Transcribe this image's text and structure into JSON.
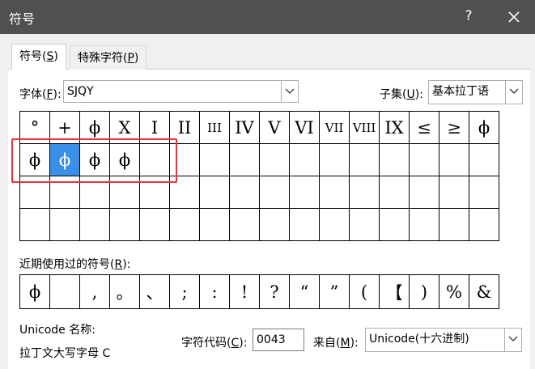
{
  "window": {
    "title": "符号",
    "help": "?"
  },
  "tabs": [
    {
      "label": "符号(",
      "hotkey": "S",
      "suffix": ")"
    },
    {
      "label": "特殊字符(",
      "hotkey": "P",
      "suffix": ")"
    }
  ],
  "font": {
    "label_pre": "字体(",
    "hotkey": "F",
    "label_post": "):",
    "value": "SJQY"
  },
  "subset": {
    "label_pre": "子集(",
    "hotkey": "U",
    "label_post": "):",
    "value": "基本拉丁语"
  },
  "symbol_grid": {
    "rows": [
      [
        "°",
        "+",
        "ϕ",
        "X",
        "I",
        "II",
        "III",
        "IV",
        "V",
        "VI",
        "VII",
        "VIII",
        "IX",
        "≤",
        "≥",
        "ϕ"
      ],
      [
        "ϕ",
        "ϕ",
        "ϕ",
        "ϕ",
        "",
        "",
        "",
        "",
        "",
        "",
        "",
        "",
        "",
        "",
        "",
        ""
      ],
      [
        "",
        "",
        "",
        "",
        "",
        "",
        "",
        "",
        "",
        "",
        "",
        "",
        "",
        "",
        "",
        ""
      ],
      [
        "",
        "",
        "",
        "",
        "",
        "",
        "",
        "",
        "",
        "",
        "",
        "",
        "",
        "",
        "",
        ""
      ]
    ]
  },
  "recent": {
    "label_pre": "近期使用过的符号(",
    "hotkey": "R",
    "label_post": "):",
    "items": [
      "ϕ",
      "",
      ",",
      "。",
      "、",
      ";",
      ":",
      "!",
      "?",
      "“",
      "”",
      "(",
      "【",
      ")",
      "%",
      "&"
    ]
  },
  "unicode_name": {
    "label": "Unicode 名称:",
    "value": "拉丁文大写字母 C"
  },
  "char_code": {
    "label_pre": "字符代码(",
    "hotkey": "C",
    "label_post": "):",
    "value": "0043"
  },
  "from": {
    "label_pre": "来自(",
    "hotkey": "M",
    "label_post": "):",
    "value": "Unicode(十六进制)"
  }
}
